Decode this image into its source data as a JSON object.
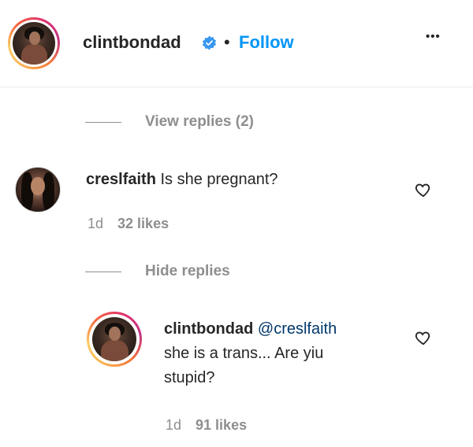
{
  "header": {
    "username": "clintbondad",
    "separator": "•",
    "follow_label": "Follow",
    "more_label": "•••"
  },
  "thread": {
    "view_replies_label": "View replies (2)",
    "hide_replies_label": "Hide replies"
  },
  "comment": {
    "username": "creslfaith",
    "text": "Is she pregnant?",
    "age": "1d",
    "likes": "32 likes"
  },
  "reply": {
    "username": "clintbondad",
    "mention": "@creslfaith",
    "text_line1": "she is a trans... Are yiu",
    "text_line2": "stupid?",
    "age": "1d",
    "likes": "91 likes"
  },
  "colors": {
    "link_blue": "#0095f6",
    "verified_blue": "#3897f0",
    "muted_gray": "#8e8e8e",
    "text_dark": "#262626"
  },
  "icons": {
    "verified": "verified-badge-icon",
    "heart": "heart-outline-icon",
    "more": "more-options-icon"
  }
}
